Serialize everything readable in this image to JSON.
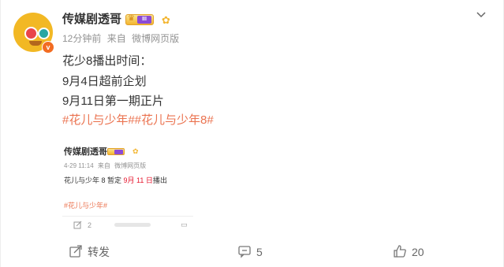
{
  "post": {
    "username": "传媒剧透哥",
    "vip_level": "III",
    "meta": {
      "time": "12分钟前",
      "source_prefix": "来自",
      "source": "微博网页版"
    },
    "lines": [
      "花少8播出时间：",
      "9月4日超前企划",
      "9月11日第一期正片",
      "#花儿与少年##花儿与少年8#"
    ]
  },
  "quoted": {
    "username": "传媒剧透哥",
    "meta": {
      "date": "4-29 11:14",
      "source_prefix": "来自",
      "source": "微博网页版"
    },
    "text_before": "花儿与少年 8 暂定 ",
    "text_highlight": "9月 11 日",
    "text_after": "播出",
    "tag": "#花儿与少年#",
    "repost_count": "2"
  },
  "footer": {
    "repost_label": "转发",
    "comment_count": "5",
    "like_count": "20"
  },
  "colors": {
    "accent_orange": "#eb7350",
    "highlight_red": "#e6162d",
    "muted": "#939393"
  }
}
